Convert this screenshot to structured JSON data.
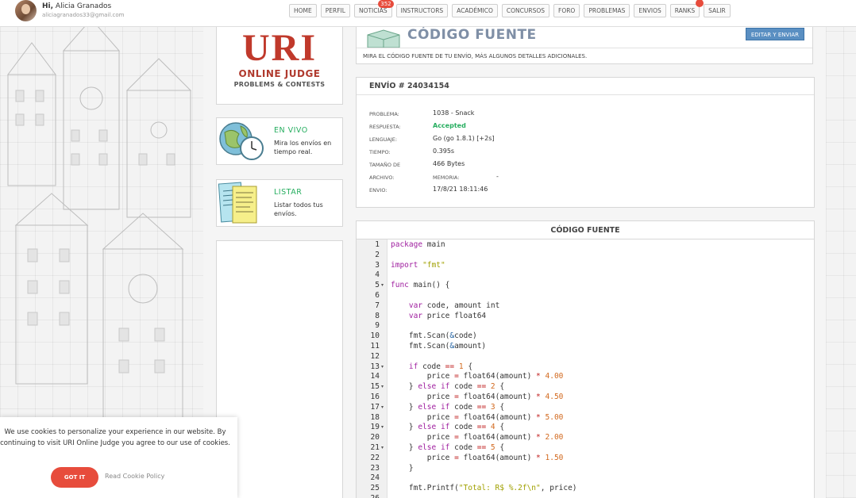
{
  "user": {
    "greeting": "Hi,",
    "name": "Alicia Granados",
    "email": "aliciagranados33@gmail.com"
  },
  "nav": {
    "items": [
      {
        "label": "HOME"
      },
      {
        "label": "PERFIL"
      },
      {
        "label": "NOTICIAS",
        "badge": "352"
      },
      {
        "label": "INSTRUCTORS"
      },
      {
        "label": "ACADÉMICO"
      },
      {
        "label": "CONCURSOS"
      },
      {
        "label": "FORO"
      },
      {
        "label": "PROBLEMAS"
      },
      {
        "label": "ENVIOS"
      },
      {
        "label": "RANKS"
      },
      {
        "label": "SALIR"
      }
    ]
  },
  "logo": {
    "main": "URI",
    "line1": "ONLINE JUDGE",
    "line2": "PROBLEMS & CONTESTS"
  },
  "side": {
    "live": {
      "title": "EN VIVO",
      "desc": "Mira los envíos en tiempo real."
    },
    "list": {
      "title": "LISTAR",
      "desc": "Listar todos tus envíos."
    }
  },
  "header": {
    "title": "CÓDIGO FUENTE",
    "button": "EDITAR Y ENVIAR",
    "desc": "MIRA EL CÓDIGO FUENTE DE TU ENVÍO, MÁS ALGUNOS DETALLES ADICIONALES."
  },
  "submission": {
    "title": "ENVÍO # 24034154",
    "problem_label": "PROBLEMA:",
    "problem": "1038 - Snack",
    "answer_label": "RESPUESTA:",
    "answer": "Accepted",
    "language_label": "LENGUAJE:",
    "language": "Go (go 1.8.1) [+2s]",
    "time_label": "TIEMPO:",
    "time": "0.395s",
    "size_label": "TAMAÑO DE ARCHIVO:",
    "size_label_1": "TAMAÑO DE",
    "size_label_2": "ARCHIVO:",
    "size": "466 Bytes",
    "memory_label": "MEMORIA:",
    "memory": "-",
    "date_label": "ENVIO:",
    "date": "17/8/21 18:11:46"
  },
  "source": {
    "title": "CÓDIGO FUENTE",
    "lines": [
      "package main",
      "",
      "import \"fmt\"",
      "",
      "func main() {",
      "",
      "    var code, amount int",
      "    var price float64",
      "",
      "    fmt.Scan(&code)",
      "    fmt.Scan(&amount)",
      "",
      "    if code == 1 {",
      "        price = float64(amount) * 4.00",
      "    } else if code == 2 {",
      "        price = float64(amount) * 4.50",
      "    } else if code == 3 {",
      "        price = float64(amount) * 5.00",
      "    } else if code == 4 {",
      "        price = float64(amount) * 2.00",
      "    } else if code == 5 {",
      "        price = float64(amount) * 1.50",
      "    }",
      "",
      "    fmt.Printf(\"Total: R$ %.2f\\n\", price)",
      ""
    ],
    "fold_lines": [
      5,
      13,
      15,
      17,
      19,
      21
    ]
  },
  "cookie": {
    "text": "We use cookies to personalize your experience in our website. By continuing to visit URI Online Judge you agree to our use of cookies.",
    "button": "GOT IT",
    "link": "Read Cookie Policy"
  },
  "colors": {
    "accent_red": "#e74c3c",
    "accepted_green": "#27ae60",
    "button_blue": "#5a8fc2"
  }
}
